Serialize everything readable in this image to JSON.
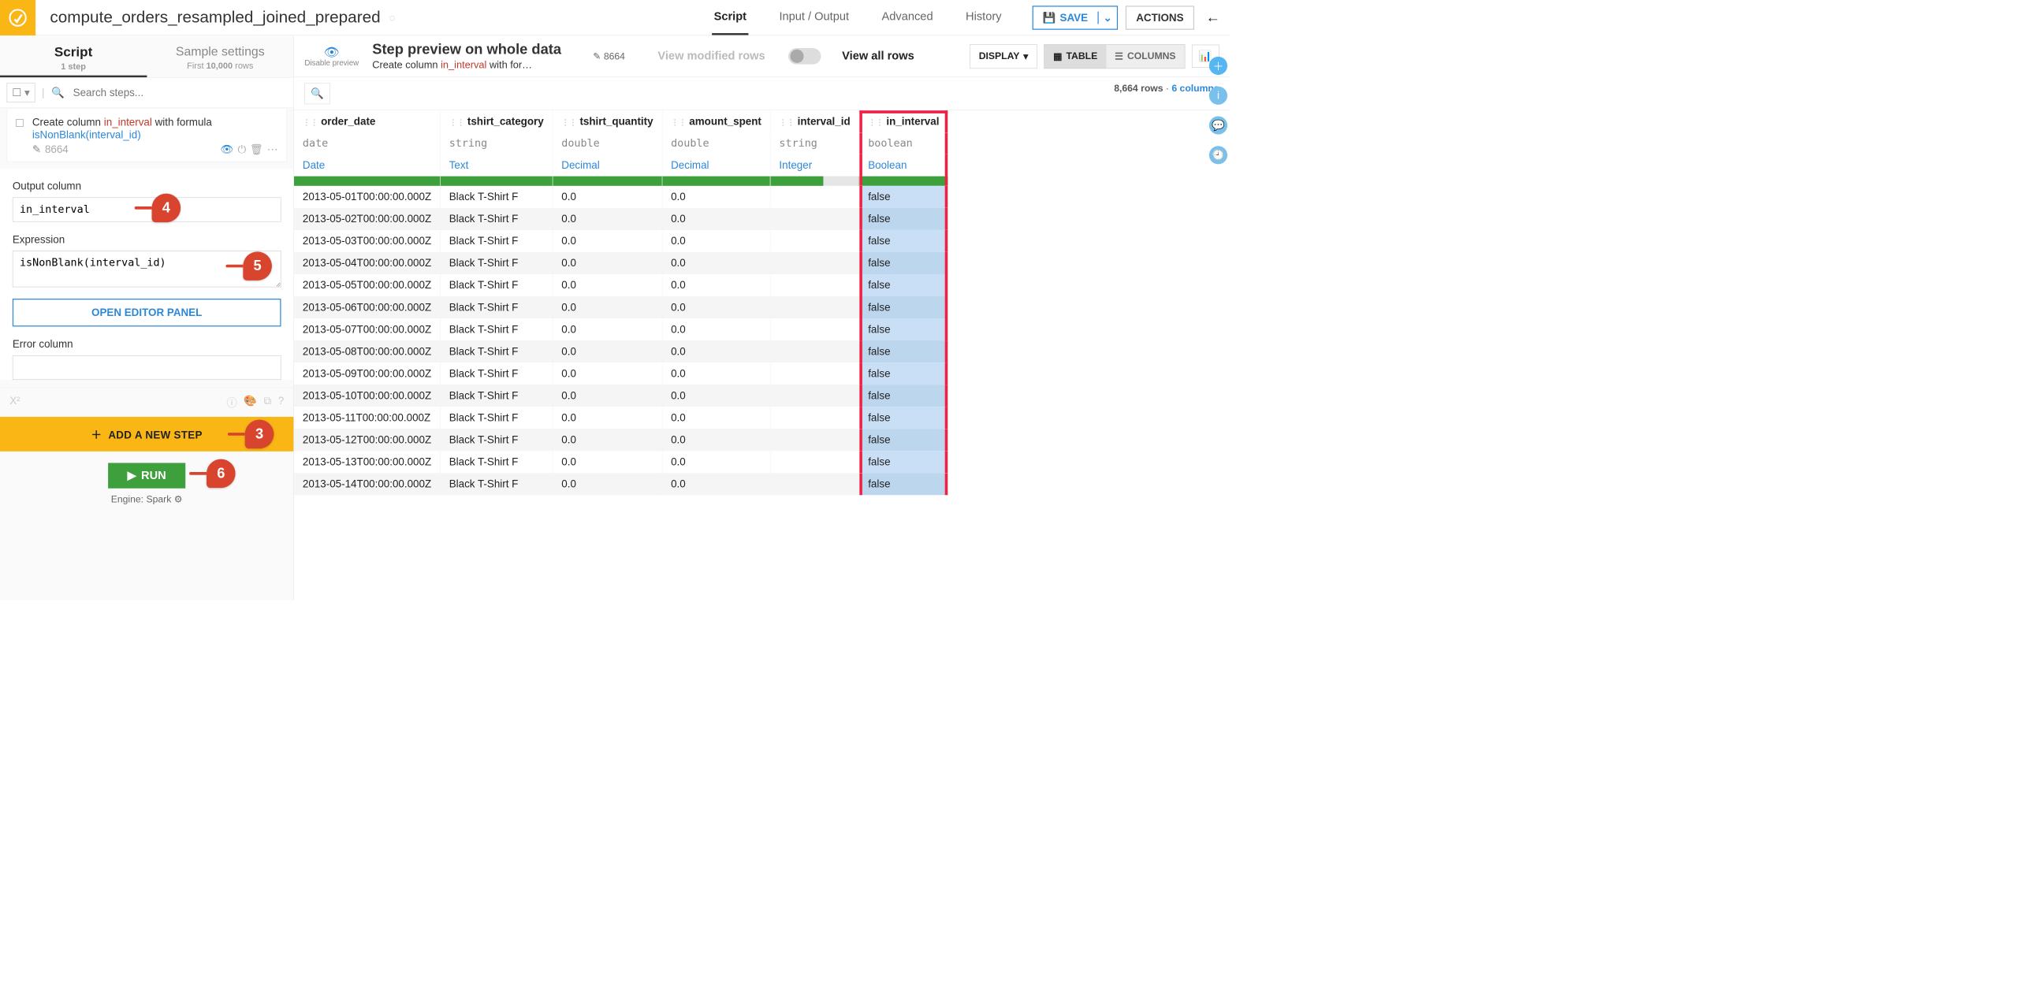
{
  "header": {
    "title": "compute_orders_resampled_joined_prepared",
    "tabs": [
      "Script",
      "Input / Output",
      "Advanced",
      "History"
    ],
    "active_tab": "Script",
    "save_label": "SAVE",
    "actions_label": "ACTIONS"
  },
  "sidebar": {
    "tabs": {
      "script": {
        "label": "Script",
        "sub_count": "1",
        "sub_text": "step"
      },
      "sample": {
        "label": "Sample settings",
        "sub_prefix": "First",
        "sub_count": "10,000",
        "sub_suffix": "rows"
      }
    },
    "search_placeholder": "Search steps...",
    "step": {
      "desc_prefix": "Create column",
      "desc_col": "in_interval",
      "desc_mid": "with formula",
      "desc_fn": "isNonBlank(interval_id)",
      "count": "8664"
    },
    "form": {
      "output_label": "Output column",
      "output_value": "in_interval",
      "expr_label": "Expression",
      "expr_value": "isNonBlank(interval_id)",
      "editor_btn": "OPEN EDITOR PANEL",
      "error_label": "Error column"
    },
    "add_step": "ADD A NEW STEP",
    "run": "RUN",
    "engine_label": "Engine:",
    "engine_value": "Spark"
  },
  "preview": {
    "disable": "Disable preview",
    "title": "Step preview on whole data",
    "sub_prefix": "Create column",
    "sub_col": "in_interval",
    "sub_suffix": "with for…",
    "count": "8664",
    "modified": "View modified rows",
    "view_all": "View all rows",
    "display": "DISPLAY",
    "table": "TABLE",
    "columns": "COLUMNS",
    "row_count": "8,664 rows",
    "col_count": "6 columns"
  },
  "table": {
    "columns": [
      {
        "name": "order_date",
        "type": "date",
        "meaning": "Date",
        "partial": false
      },
      {
        "name": "tshirt_category",
        "type": "string",
        "meaning": "Text",
        "partial": false
      },
      {
        "name": "tshirt_quantity",
        "type": "double",
        "meaning": "Decimal",
        "partial": false,
        "align": "right"
      },
      {
        "name": "amount_spent",
        "type": "double",
        "meaning": "Decimal",
        "partial": false,
        "align": "right"
      },
      {
        "name": "interval_id",
        "type": "string",
        "meaning": "Integer",
        "partial": true
      },
      {
        "name": "in_interval",
        "type": "boolean",
        "meaning": "Boolean",
        "partial": false,
        "highlight": true
      }
    ],
    "rows": [
      [
        "2013-05-01T00:00:00.000Z",
        "Black T-Shirt F",
        "0.0",
        "0.0",
        "",
        "false"
      ],
      [
        "2013-05-02T00:00:00.000Z",
        "Black T-Shirt F",
        "0.0",
        "0.0",
        "",
        "false"
      ],
      [
        "2013-05-03T00:00:00.000Z",
        "Black T-Shirt F",
        "0.0",
        "0.0",
        "",
        "false"
      ],
      [
        "2013-05-04T00:00:00.000Z",
        "Black T-Shirt F",
        "0.0",
        "0.0",
        "",
        "false"
      ],
      [
        "2013-05-05T00:00:00.000Z",
        "Black T-Shirt F",
        "0.0",
        "0.0",
        "",
        "false"
      ],
      [
        "2013-05-06T00:00:00.000Z",
        "Black T-Shirt F",
        "0.0",
        "0.0",
        "",
        "false"
      ],
      [
        "2013-05-07T00:00:00.000Z",
        "Black T-Shirt F",
        "0.0",
        "0.0",
        "",
        "false"
      ],
      [
        "2013-05-08T00:00:00.000Z",
        "Black T-Shirt F",
        "0.0",
        "0.0",
        "",
        "false"
      ],
      [
        "2013-05-09T00:00:00.000Z",
        "Black T-Shirt F",
        "0.0",
        "0.0",
        "",
        "false"
      ],
      [
        "2013-05-10T00:00:00.000Z",
        "Black T-Shirt F",
        "0.0",
        "0.0",
        "",
        "false"
      ],
      [
        "2013-05-11T00:00:00.000Z",
        "Black T-Shirt F",
        "0.0",
        "0.0",
        "",
        "false"
      ],
      [
        "2013-05-12T00:00:00.000Z",
        "Black T-Shirt F",
        "0.0",
        "0.0",
        "",
        "false"
      ],
      [
        "2013-05-13T00:00:00.000Z",
        "Black T-Shirt F",
        "0.0",
        "0.0",
        "",
        "false"
      ],
      [
        "2013-05-14T00:00:00.000Z",
        "Black T-Shirt F",
        "0.0",
        "0.0",
        "",
        "false"
      ]
    ]
  },
  "callouts": {
    "3": "3",
    "4": "4",
    "5": "5",
    "6": "6"
  }
}
